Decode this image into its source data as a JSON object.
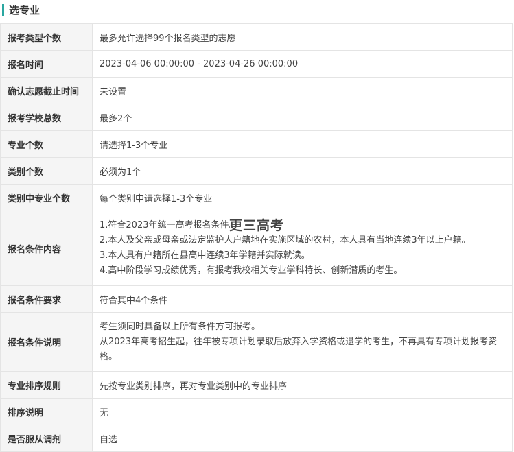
{
  "section": {
    "title": "选专业"
  },
  "rows": [
    {
      "label": "报考类型个数",
      "value": "最多允许选择99个报名类型的志愿"
    },
    {
      "label": "报名时间",
      "value": "2023-04-06 00:00:00 - 2023-04-26 00:00:00"
    },
    {
      "label": "确认志愿截止时间",
      "value": "未设置"
    },
    {
      "label": "报考学校总数",
      "value": "最多2个"
    },
    {
      "label": "专业个数",
      "value": "请选择1-3个专业"
    },
    {
      "label": "类别个数",
      "value": "必须为1个"
    },
    {
      "label": "类别中专业个数",
      "value": "每个类别中请选择1-3个专业"
    },
    {
      "label": "报名条件内容",
      "lines": [
        "1.符合2023年统一高考报名条件。",
        "2.本人及父亲或母亲或法定监护人户籍地在实施区域的农村，本人具有当地连续3年以上户籍。",
        "3.本人具有户籍所在县高中连续3年学籍并实际就读。",
        "4.高中阶段学习成绩优秀，有报考我校相关专业学科特长、创新潜质的考生。"
      ]
    },
    {
      "label": "报名条件要求",
      "value": "符合其中4个条件"
    },
    {
      "label": "报名条件说明",
      "lines": [
        "考生须同时具备以上所有条件方可报考。",
        "从2023年高考招生起，往年被专项计划录取后放弃入学资格或退学的考生，不再具有专项计划报考资格。"
      ]
    },
    {
      "label": "专业排序规则",
      "value": "先按专业类别排序，再对专业类别中的专业排序"
    },
    {
      "label": "排序说明",
      "value": "无"
    },
    {
      "label": "是否服从调剂",
      "value": "自选"
    }
  ],
  "watermark": "更三高考",
  "colors": {
    "accent": "#2aa7a1",
    "label_bg": "#f5f5f5",
    "border": "#e4e4e4"
  }
}
